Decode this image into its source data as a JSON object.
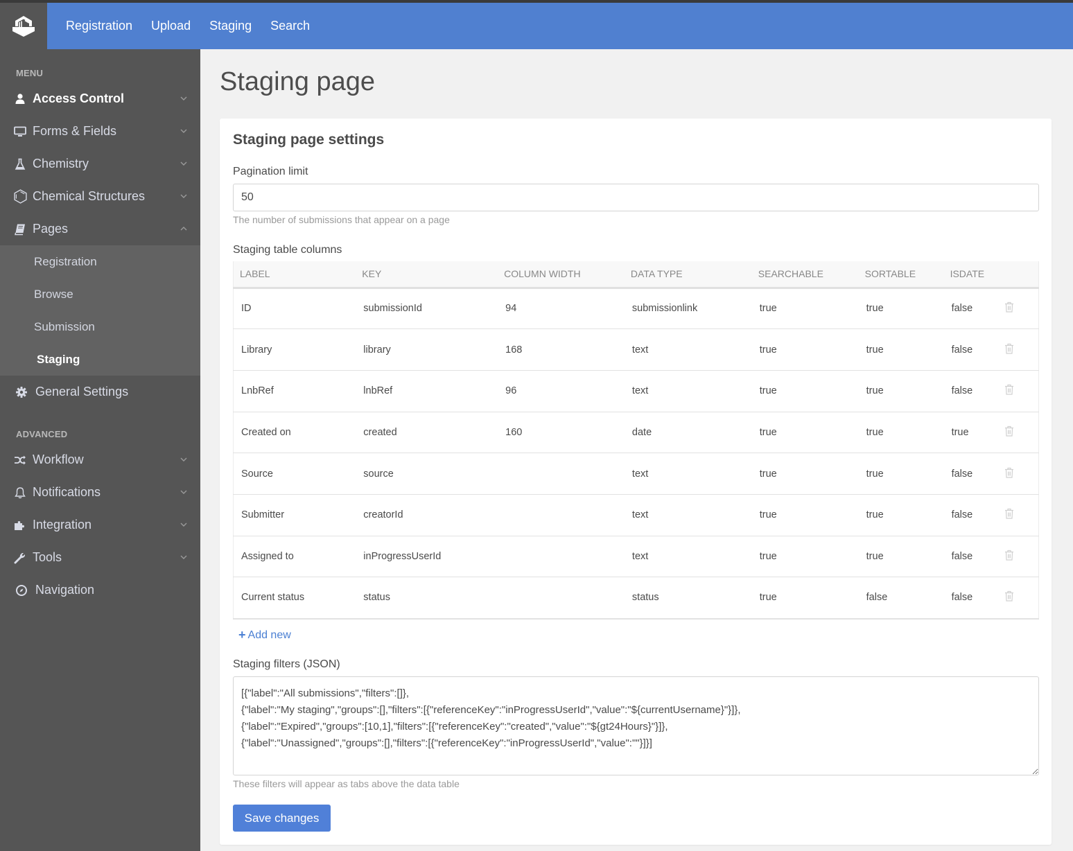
{
  "topnav": {
    "logo": "app-logo",
    "links": [
      "Registration",
      "Upload",
      "Staging",
      "Search"
    ]
  },
  "sidebar": {
    "menu_label": "MENU",
    "advanced_label": "ADVANCED",
    "items": [
      {
        "label": "Access Control",
        "icon": "user-icon",
        "expanded": false
      },
      {
        "label": "Forms & Fields",
        "icon": "monitor-icon",
        "expanded": false
      },
      {
        "label": "Chemistry",
        "icon": "flask-icon",
        "expanded": false
      },
      {
        "label": "Chemical Structures",
        "icon": "benzene-icon",
        "expanded": false
      },
      {
        "label": "Pages",
        "icon": "book-icon",
        "expanded": true
      },
      {
        "label": "General Settings",
        "icon": "gear-icon"
      }
    ],
    "pages_sub": [
      "Registration",
      "Browse",
      "Submission",
      "Staging"
    ],
    "active_sub": "Staging",
    "advanced_items": [
      {
        "label": "Workflow",
        "icon": "shuffle-icon"
      },
      {
        "label": "Notifications",
        "icon": "bell-icon"
      },
      {
        "label": "Integration",
        "icon": "puzzle-icon"
      },
      {
        "label": "Tools",
        "icon": "wrench-icon"
      },
      {
        "label": "Navigation",
        "icon": "compass-icon"
      }
    ]
  },
  "main": {
    "page_title": "Staging page",
    "card_title": "Staging page settings",
    "pagination": {
      "label": "Pagination limit",
      "value": "50",
      "help": "The number of submissions that appear on a page"
    },
    "columns_label": "Staging table columns",
    "table": {
      "headers": [
        "LABEL",
        "KEY",
        "COLUMN WIDTH",
        "DATA TYPE",
        "SEARCHABLE",
        "SORTABLE",
        "ISDATE"
      ],
      "rows": [
        [
          "ID",
          "submissionId",
          "94",
          "submissionlink",
          "true",
          "true",
          "false"
        ],
        [
          "Library",
          "library",
          "168",
          "text",
          "true",
          "true",
          "false"
        ],
        [
          "LnbRef",
          "lnbRef",
          "96",
          "text",
          "true",
          "true",
          "false"
        ],
        [
          "Created on",
          "created",
          "160",
          "date",
          "true",
          "true",
          "true"
        ],
        [
          "Source",
          "source",
          "",
          "text",
          "true",
          "true",
          "false"
        ],
        [
          "Submitter",
          "creatorId",
          "",
          "text",
          "true",
          "true",
          "false"
        ],
        [
          "Assigned to",
          "inProgressUserId",
          "",
          "text",
          "true",
          "true",
          "false"
        ],
        [
          "Current status",
          "status",
          "",
          "status",
          "true",
          "false",
          "false"
        ]
      ]
    },
    "add_new_label": "Add new",
    "filters": {
      "label": "Staging filters (JSON)",
      "value": "[{\"label\":\"All submissions\",\"filters\":[]},\n{\"label\":\"My staging\",\"groups\":[],\"filters\":[{\"referenceKey\":\"inProgressUserId\",\"value\":\"${currentUsername}\"}]},\n{\"label\":\"Expired\",\"groups\":[10,1],\"filters\":[{\"referenceKey\":\"created\",\"value\":\"${gt24Hours}\"}]},\n{\"label\":\"Unassigned\",\"groups\":[],\"filters\":[{\"referenceKey\":\"inProgressUserId\",\"value\":\"\"}]}]",
      "help": "These filters will appear as tabs above the data table"
    },
    "save_label": "Save changes"
  },
  "colors": {
    "accent": "#5080d0",
    "sidebar_bg": "#555555",
    "submenu_bg": "#626262",
    "link": "#4a7fd3"
  }
}
